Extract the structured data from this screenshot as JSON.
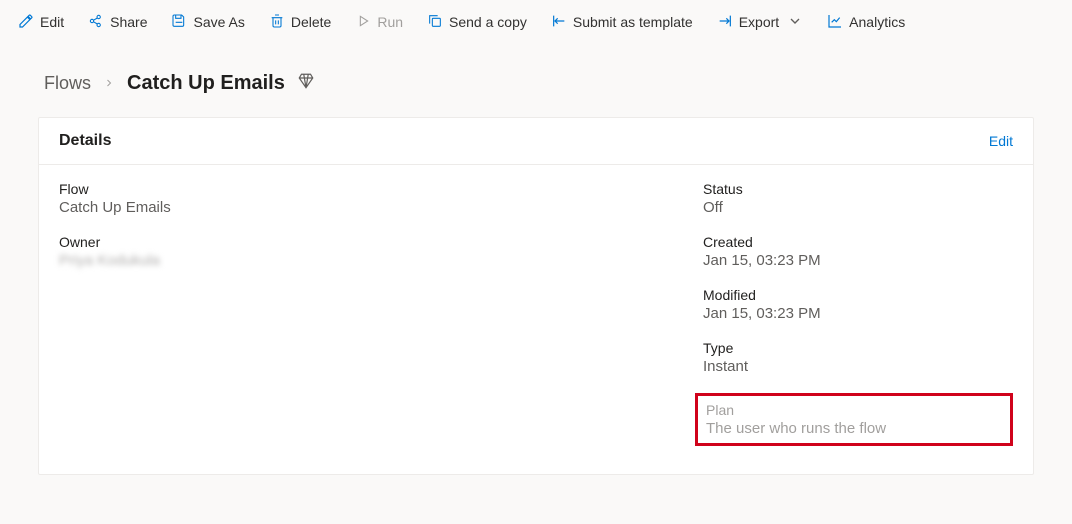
{
  "toolbar": {
    "edit": "Edit",
    "share": "Share",
    "saveAs": "Save As",
    "delete": "Delete",
    "run": "Run",
    "sendCopy": "Send a copy",
    "submitTemplate": "Submit as template",
    "export": "Export",
    "analytics": "Analytics"
  },
  "breadcrumb": {
    "root": "Flows",
    "current": "Catch Up Emails"
  },
  "card": {
    "title": "Details",
    "editLink": "Edit",
    "left": {
      "flowLabel": "Flow",
      "flowValue": "Catch Up Emails",
      "ownerLabel": "Owner",
      "ownerValue": "Priya Kodukula"
    },
    "right": {
      "statusLabel": "Status",
      "statusValue": "Off",
      "createdLabel": "Created",
      "createdValue": "Jan 15, 03:23 PM",
      "modifiedLabel": "Modified",
      "modifiedValue": "Jan 15, 03:23 PM",
      "typeLabel": "Type",
      "typeValue": "Instant",
      "planLabel": "Plan",
      "planValue": "The user who runs the flow"
    }
  }
}
